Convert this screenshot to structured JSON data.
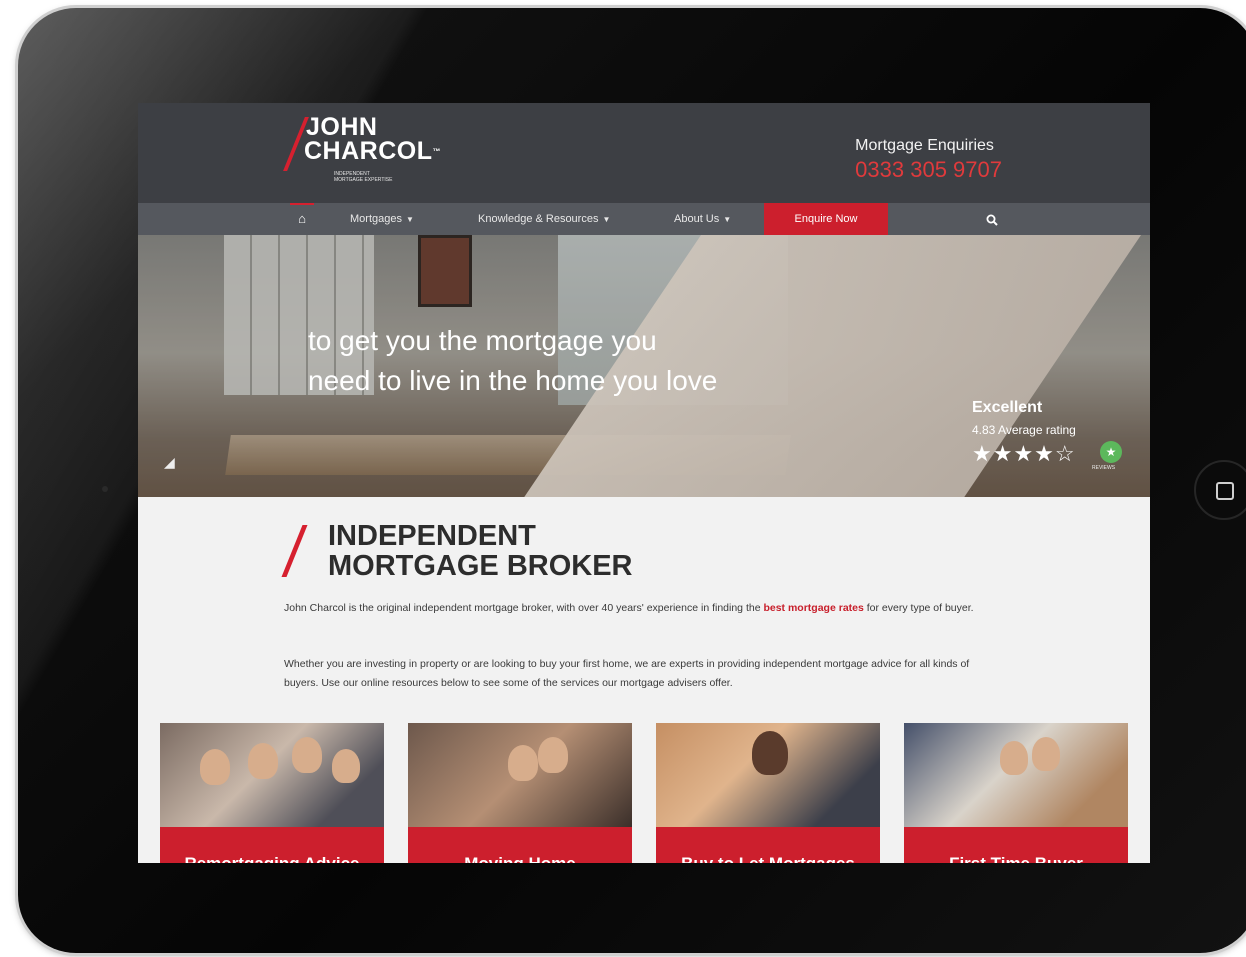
{
  "header": {
    "logo": {
      "line1": "JOHN",
      "line2": "CHARCOL",
      "tm": "™",
      "tagline_1": "INDEPENDENT",
      "tagline_2": "MORTGAGE EXPERTISE"
    },
    "enquiries_label": "Mortgage Enquiries",
    "phone": "0333 305 9707"
  },
  "nav": {
    "home_icon": "home-icon",
    "items": [
      {
        "label": "Mortgages"
      },
      {
        "label": "Knowledge & Resources"
      },
      {
        "label": "About Us"
      }
    ],
    "cta": "Enquire Now",
    "search_icon": "search-icon"
  },
  "hero": {
    "line1": "to get you the mortgage you",
    "line2": "need to live in the home you love",
    "rating_title": "Excellent",
    "rating_text": "4.83 Average rating",
    "stars": "★★★★☆",
    "reviews_label": "REVIEWS"
  },
  "intro": {
    "heading_1": "INDEPENDENT",
    "heading_2": "MORTGAGE BROKER",
    "p1_a": "John Charcol is the original independent mortgage broker, with over 40 years' experience in finding the",
    "p1_link": "best mortgage rates",
    "p1_b": "for every type of buyer.",
    "p2": "Whether you are investing in property or are looking to buy your first home, we are experts in providing independent mortgage advice for all kinds of buyers. Use our online resources below to see some of the services our mortgage advisers offer."
  },
  "cards": [
    {
      "title": "Remortgaging Advice"
    },
    {
      "title": "Moving Home"
    },
    {
      "title": "Buy to Let Mortgages"
    },
    {
      "title": "First Time Buyer"
    }
  ],
  "colors": {
    "brand_red": "#cc1f2d",
    "header_bg": "#3d3f44",
    "nav_bg": "#55585e"
  }
}
